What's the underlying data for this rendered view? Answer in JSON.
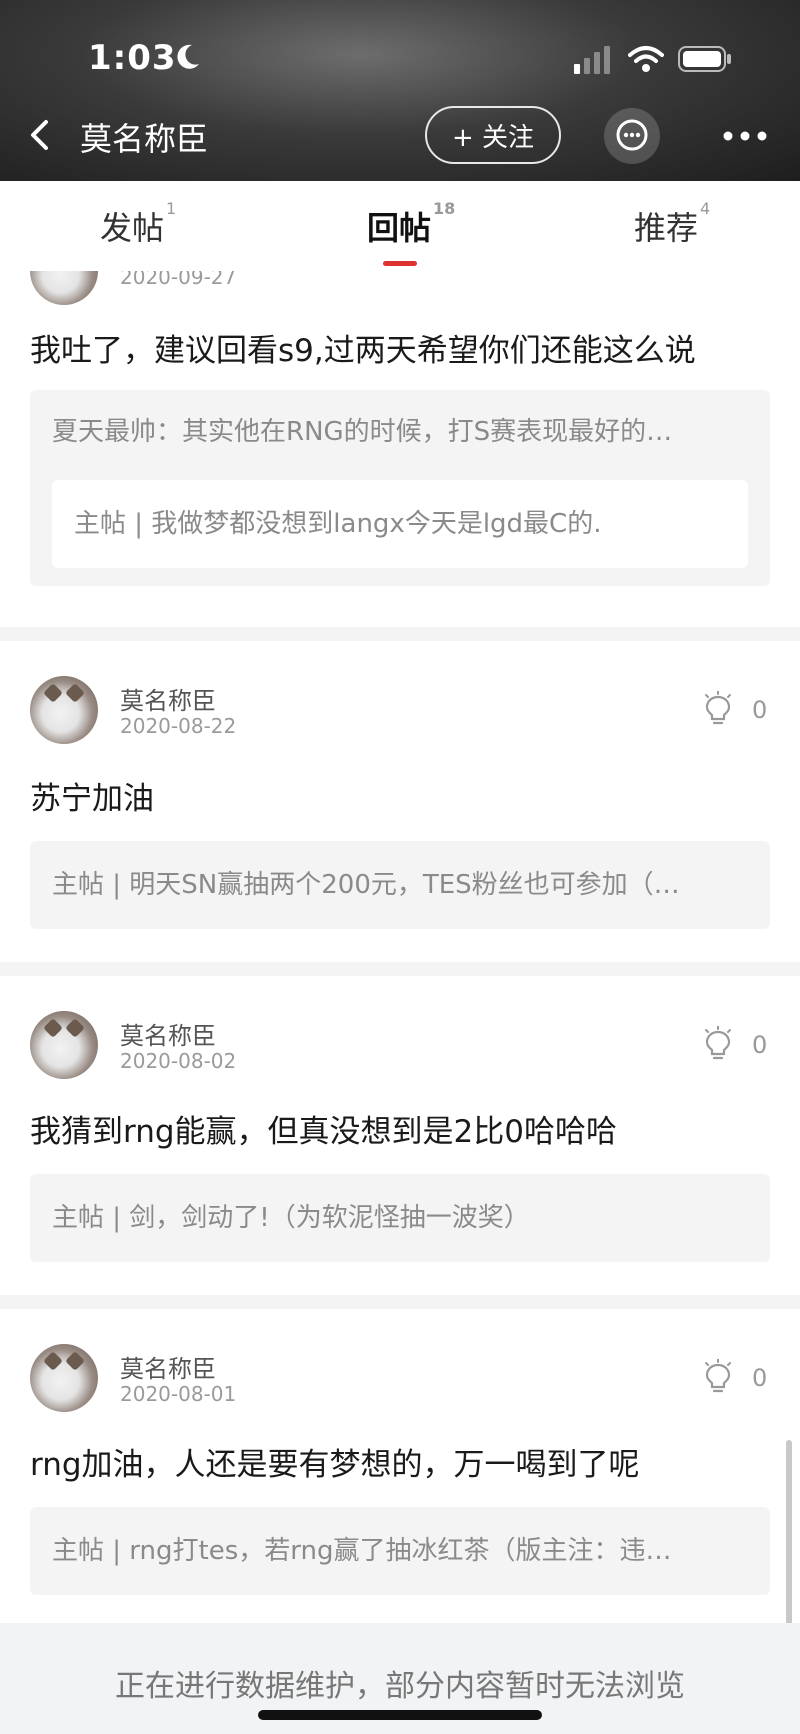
{
  "status_bar": {
    "time": "1:03"
  },
  "nav": {
    "title": "莫名称臣",
    "follow_label": "+ 关注"
  },
  "tabs": [
    {
      "label": "发帖",
      "count": "1"
    },
    {
      "label": "回帖",
      "count": "18"
    },
    {
      "label": "推荐",
      "count": "4"
    }
  ],
  "posts": [
    {
      "date": "2020-09-27",
      "content": "我吐了，建议回看s9,过两天希望你们还能这么说",
      "quote": "夏天最帅：其实他在RNG的时候，打S赛表现最好的…",
      "main_post": "主帖 | 我做梦都没想到langx今天是lgd最C的."
    },
    {
      "username": "莫名称臣",
      "date": "2020-08-22",
      "likes": "0",
      "content": "苏宁加油",
      "main_post": "主帖 | 明天SN赢抽两个200元，TES粉丝也可参加（…"
    },
    {
      "username": "莫名称臣",
      "date": "2020-08-02",
      "likes": "0",
      "content": "我猜到rng能赢，但真没想到是2比0哈哈哈",
      "main_post": "主帖 | 剑，剑动了!（为软泥怪抽一波奖）"
    },
    {
      "username": "莫名称臣",
      "date": "2020-08-01",
      "likes": "0",
      "content": "rng加油，人还是要有梦想的，万一喝到了呢",
      "main_post": "主帖 | rng打tes，若rng赢了抽冰红茶（版主注：违…"
    }
  ],
  "footer": {
    "notice": "正在进行数据维护，部分内容暂时无法浏览"
  },
  "colors": {
    "accent": "#e03131",
    "quote_bg": "#f4f4f4",
    "footer_bg": "#f2f3f5"
  }
}
